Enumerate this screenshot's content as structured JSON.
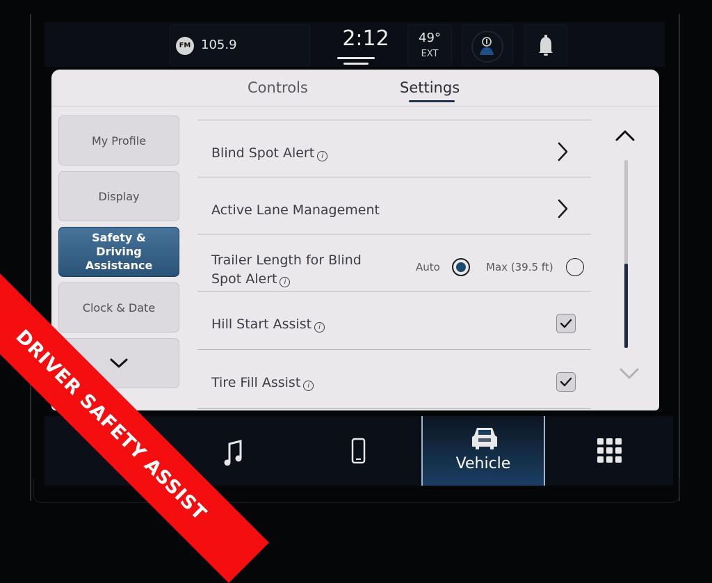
{
  "status_bar": {
    "radio_band": "FM",
    "radio_frequency": "105.9",
    "time": "2:12",
    "temperature": "49°",
    "temperature_label": "EXT"
  },
  "tabs": [
    {
      "label": "Controls",
      "active": false
    },
    {
      "label": "Settings",
      "active": true
    }
  ],
  "sidebar": {
    "items": [
      {
        "label": "My Profile",
        "active": false
      },
      {
        "label": "Display",
        "active": false
      },
      {
        "label": "Safety & Driving Assistance",
        "active": true
      },
      {
        "label": "Clock & Date",
        "active": false
      }
    ],
    "more_label": "⌄"
  },
  "settings": {
    "blind_spot_alert": {
      "label": "Blind Spot Alert",
      "info": "i"
    },
    "active_lane_management": {
      "label": "Active Lane Management"
    },
    "trailer_length": {
      "label_line1": "Trailer Length for Blind",
      "label_line2": "Spot Alert",
      "info": "i",
      "options": [
        {
          "label": "Auto",
          "selected": true
        },
        {
          "label": "Max (39.5 ft)",
          "selected": false
        }
      ]
    },
    "hill_start_assist": {
      "label": "Hill Start Assist",
      "info": "i",
      "checked": true
    },
    "tire_fill_assist": {
      "label": "Tire Fill Assist",
      "info": "i",
      "checked": true
    }
  },
  "scrollbar": {
    "position_fraction": 0.55,
    "visible_fraction": 0.45
  },
  "bottom_nav": {
    "items": [
      {
        "icon": "music-note-icon",
        "label": ""
      },
      {
        "icon": "phone-icon",
        "label": ""
      },
      {
        "icon": "vehicle-icon",
        "label": "Vehicle",
        "active": true
      },
      {
        "icon": "apps-grid-icon",
        "label": ""
      }
    ]
  },
  "banner": {
    "text": "DRIVER SAFETY ASSIST",
    "color": "#f40e10"
  },
  "colors": {
    "accent": "#2a5378",
    "panel": "#ebe8ec",
    "background": "#050608"
  }
}
